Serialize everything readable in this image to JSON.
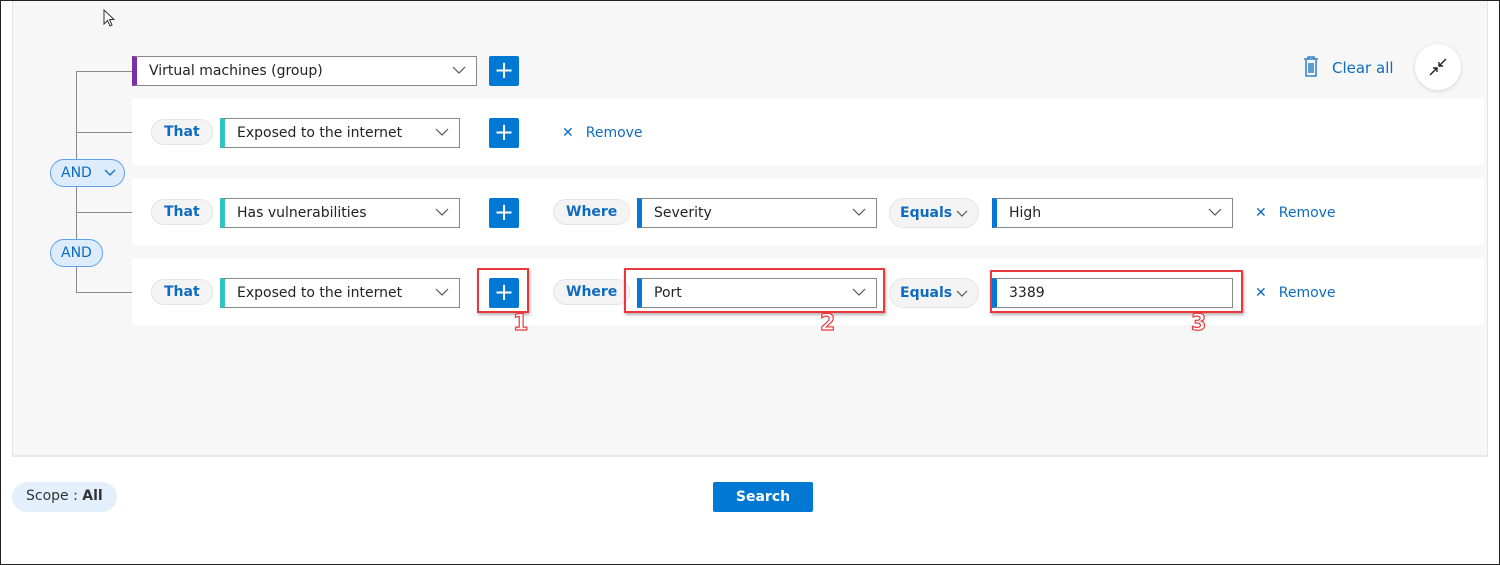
{
  "header": {
    "clear_all": "Clear all"
  },
  "root": {
    "value": "Virtual machines (group)"
  },
  "operators": [
    "AND",
    "AND"
  ],
  "rows": [
    {
      "that": "That",
      "condition": "Exposed to the internet",
      "remove": "Remove"
    },
    {
      "that": "That",
      "condition": "Has vulnerabilities",
      "where": "Where",
      "field": "Severity",
      "operator": "Equals",
      "value": "High",
      "remove": "Remove"
    },
    {
      "that": "That",
      "condition": "Exposed to the internet",
      "where": "Where",
      "field": "Port",
      "operator": "Equals",
      "value": "3389",
      "remove": "Remove"
    }
  ],
  "annotations": [
    "1",
    "2",
    "3"
  ],
  "footer": {
    "scope_label": "Scope : ",
    "scope_value": "All",
    "search": "Search"
  },
  "colors": {
    "accent": "#0078d4",
    "root_bar": "#7b2fa8",
    "condition_bar": "#2ec4c4",
    "annotation": "#e8383d"
  }
}
